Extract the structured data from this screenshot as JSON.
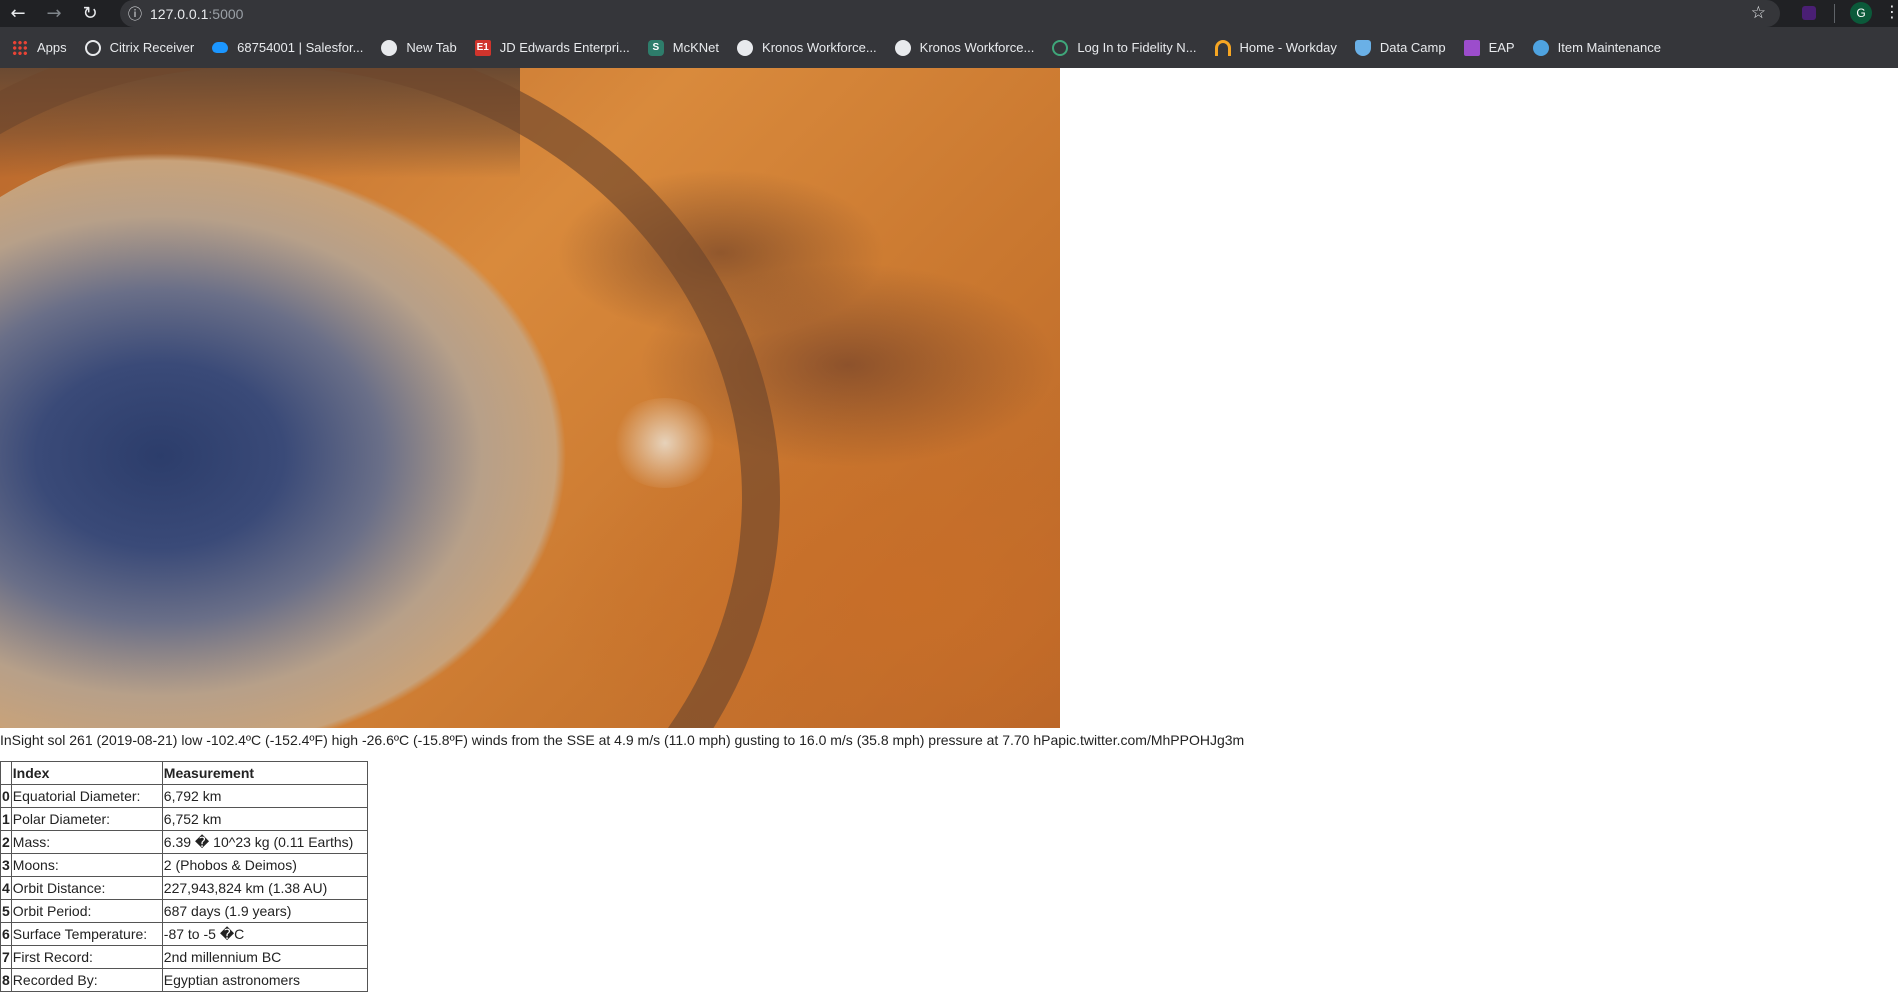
{
  "browser": {
    "url_host": "127.0.0.1",
    "url_port": ":5000",
    "profile_initial": "G"
  },
  "bookmarks": [
    {
      "label": "Apps",
      "icon": "apps-grid-icon"
    },
    {
      "label": "Citrix Receiver",
      "icon": "citrix-icon"
    },
    {
      "label": "68754001 | Salesfor...",
      "icon": "salesforce-cloud-icon"
    },
    {
      "label": "New Tab",
      "icon": "globe-icon"
    },
    {
      "label": "JD Edwards Enterpri...",
      "icon": "jde-e1-icon"
    },
    {
      "label": "McKNet",
      "icon": "mcknet-icon"
    },
    {
      "label": "Kronos Workforce...",
      "icon": "globe-icon"
    },
    {
      "label": "Kronos Workforce...",
      "icon": "globe-icon"
    },
    {
      "label": "Log In to Fidelity N...",
      "icon": "fidelity-icon"
    },
    {
      "label": "Home - Workday",
      "icon": "workday-icon"
    },
    {
      "label": "Data Camp",
      "icon": "shield-icon"
    },
    {
      "label": "EAP",
      "icon": "crown-icon"
    },
    {
      "label": "Item Maintenance",
      "icon": "world-icon"
    }
  ],
  "weather": {
    "text": "InSight sol 261 (2019-08-21) low -102.4ºC (-152.4ºF) high -26.6ºC (-15.8ºF) winds from the SSE at 4.9 m/s (11.0 mph) gusting to 16.0 m/s (35.8 mph) pressure at 7.70 hPapic.twitter.com/MhPPOHJg3m"
  },
  "facts_table": {
    "headers": [
      "",
      "Index",
      "Measurement"
    ],
    "rows": [
      {
        "index": "0",
        "label": "Equatorial Diameter:",
        "value": "6,792 km"
      },
      {
        "index": "1",
        "label": "Polar Diameter:",
        "value": "6,752 km"
      },
      {
        "index": "2",
        "label": "Mass:",
        "value": "6.39 � 10^23 kg (0.11 Earths)"
      },
      {
        "index": "3",
        "label": "Moons:",
        "value": "2 (Phobos & Deimos)"
      },
      {
        "index": "4",
        "label": "Orbit Distance:",
        "value": "227,943,824 km (1.38 AU)"
      },
      {
        "index": "5",
        "label": "Orbit Period:",
        "value": "687 days (1.9 years)"
      },
      {
        "index": "6",
        "label": "Surface Temperature:",
        "value": "-87 to -5 �C"
      },
      {
        "index": "7",
        "label": "First Record:",
        "value": "2nd millennium BC"
      },
      {
        "index": "8",
        "label": "Recorded By:",
        "value": "Egyptian astronomers"
      }
    ]
  }
}
